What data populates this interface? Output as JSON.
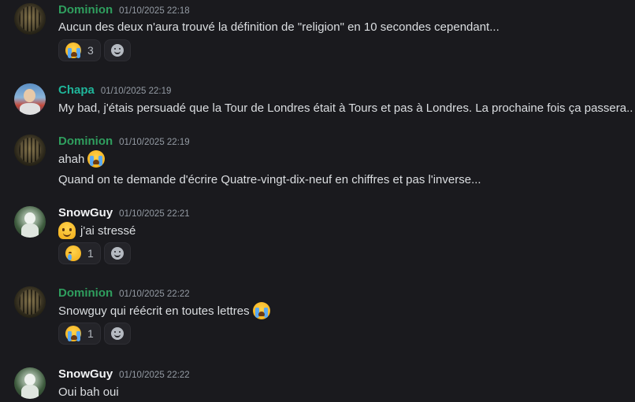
{
  "messages": [
    {
      "author": "Dominion",
      "name_color": "#2f9e5e",
      "avatar": "dominion-avatar",
      "timestamp": "01/10/2025 22:18",
      "lines": [
        "Aucun des deux n'aura trouvé la définition de \"religion\" en 10 secondes cependant..."
      ],
      "reactions": [
        {
          "emoji": "loudly-crying-face",
          "count": "3"
        }
      ]
    },
    {
      "author": "Chapa",
      "name_color": "#1fb59a",
      "avatar": "chapa-avatar",
      "timestamp": "01/10/2025 22:19",
      "lines": [
        "My bad, j'étais persuadé que la Tour de Londres était à Tours et pas à Londres. La prochaine fois ça passera.."
      ]
    },
    {
      "author": "Dominion",
      "name_color": "#2f9e5e",
      "avatar": "dominion-avatar",
      "timestamp": "01/10/2025 22:19",
      "lines": [
        "ahah",
        "Quand on te demande d'écrire  Quatre-vingt-dix-neuf en chiffres et pas l'inverse..."
      ],
      "inline_emoji": "loudly-crying-face"
    },
    {
      "author": "SnowGuy",
      "name_color": "#f2f3f5",
      "avatar": "snowguy-avatar",
      "timestamp": "01/10/2025 22:21",
      "lines": [
        "j'ai stressé"
      ],
      "inline_emoji": "melting-face",
      "reactions": [
        {
          "emoji": "face-holding-back-tears",
          "count": "1"
        }
      ]
    },
    {
      "author": "Dominion",
      "name_color": "#2f9e5e",
      "avatar": "dominion-avatar",
      "timestamp": "01/10/2025 22:22",
      "lines": [
        "Snowguy qui réécrit en toutes lettres"
      ],
      "inline_emoji": "loudly-crying-face",
      "reactions": [
        {
          "emoji": "loudly-crying-face",
          "count": "1"
        }
      ]
    },
    {
      "author": "SnowGuy",
      "name_color": "#f2f3f5",
      "avatar": "snowguy-avatar",
      "timestamp": "01/10/2025 22:22",
      "lines": [
        "Oui bah oui"
      ]
    }
  ]
}
